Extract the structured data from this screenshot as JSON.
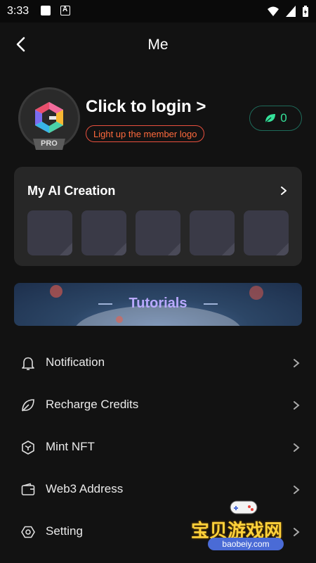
{
  "status_bar": {
    "time": "3:33"
  },
  "header": {
    "title": "Me"
  },
  "profile": {
    "login_text": "Click to login >",
    "member_link": "Light up the member logo",
    "pro_badge": "PRO",
    "points": "0"
  },
  "creation": {
    "title": "My AI Creation",
    "thumbnails": [
      "",
      "",
      "",
      "",
      ""
    ]
  },
  "banner": {
    "title": "Tutorials"
  },
  "menu": [
    {
      "label": "Notification",
      "icon": "bell-icon"
    },
    {
      "label": "Recharge Credits",
      "icon": "leaf-icon"
    },
    {
      "label": "Mint NFT",
      "icon": "cube-icon"
    },
    {
      "label": "Web3 Address",
      "icon": "wallet-icon"
    },
    {
      "label": "Setting",
      "icon": "gear-icon"
    }
  ],
  "watermark": {
    "text": "宝贝游戏网",
    "sub": "baobeiy.com"
  },
  "colors": {
    "background": "#121212",
    "card": "#272727",
    "accent_orange": "#ff6a3d",
    "accent_green": "#35e29a",
    "tutorial_text": "#b9a9ff"
  }
}
